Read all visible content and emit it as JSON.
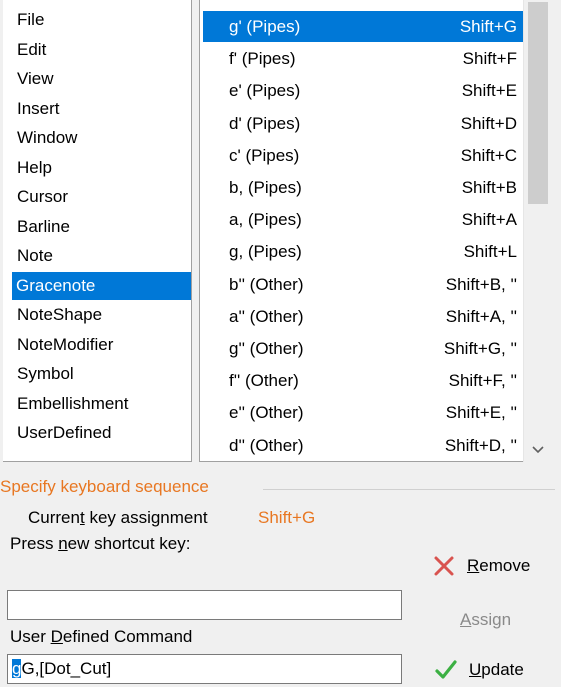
{
  "categories": {
    "items": [
      "File",
      "Edit",
      "View",
      "Insert",
      "Window",
      "Help",
      "Cursor",
      "Barline",
      "Note",
      "Gracenote",
      "NoteShape",
      "NoteModifier",
      "Symbol",
      "Embellishment",
      "UserDefined"
    ],
    "selected": "Gracenote"
  },
  "commands": {
    "rows": [
      {
        "name": "g' (Pipes)",
        "key": "Shift+G"
      },
      {
        "name": "f' (Pipes)",
        "key": "Shift+F"
      },
      {
        "name": "e' (Pipes)",
        "key": "Shift+E"
      },
      {
        "name": "d' (Pipes)",
        "key": "Shift+D"
      },
      {
        "name": "c' (Pipes)",
        "key": "Shift+C"
      },
      {
        "name": "b, (Pipes)",
        "key": "Shift+B"
      },
      {
        "name": "a, (Pipes)",
        "key": "Shift+A"
      },
      {
        "name": "g, (Pipes)",
        "key": "Shift+L"
      },
      {
        "name": "b'' (Other)",
        "key": "Shift+B, ''"
      },
      {
        "name": "a'' (Other)",
        "key": "Shift+A, ''"
      },
      {
        "name": "g'' (Other)",
        "key": "Shift+G, ''"
      },
      {
        "name": "f'' (Other)",
        "key": "Shift+F, ''"
      },
      {
        "name": "e'' (Other)",
        "key": "Shift+E, ''"
      },
      {
        "name": "d'' (Other)",
        "key": "Shift+D, ''"
      }
    ],
    "selected_index": 0
  },
  "group": {
    "title": "Specify keyboard sequence",
    "current_label_pre": "Curren",
    "current_label_ul": "t",
    "current_label_mid": " ",
    "current_label_k": "k",
    "current_label_post": "ey assignment",
    "current_value": "Shift+G",
    "press_pre": "Press ",
    "press_ul": "n",
    "press_post": "ew shortcut key:",
    "shortcut_value": "",
    "udc_pre": "User ",
    "udc_ul": "D",
    "udc_post": "efined Command",
    "udc_value_selected": "g",
    "udc_value_rest": "G,[Dot_Cut]"
  },
  "buttons": {
    "remove_ul": "R",
    "remove_rest": "emove",
    "assign_ul": "A",
    "assign_rest": "ssign",
    "update_ul": "U",
    "update_rest": "pdate"
  },
  "colors": {
    "selection": "#0078d7",
    "group_title": "#e87722",
    "remove_icon": "#d9534f",
    "update_icon": "#3cb043"
  }
}
